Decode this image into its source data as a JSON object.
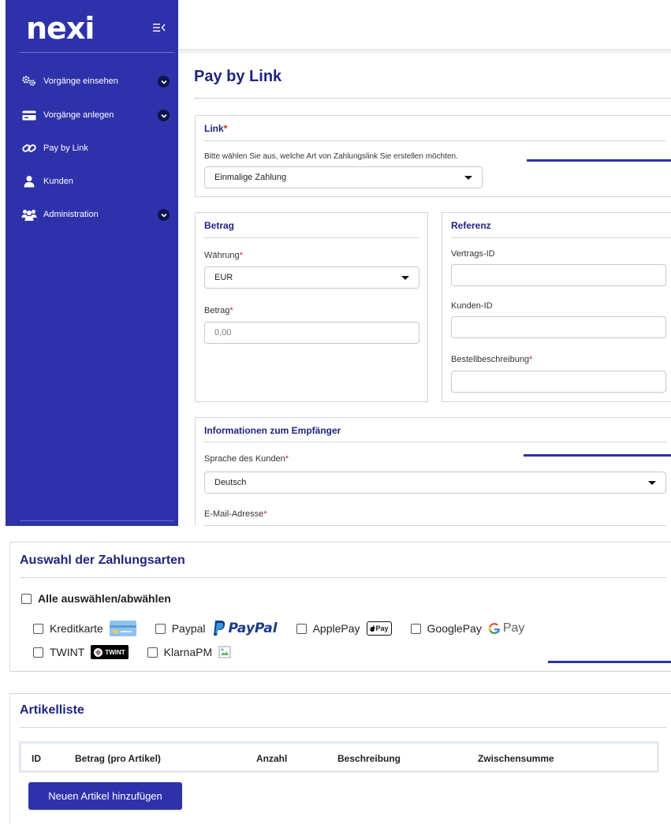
{
  "app": {
    "logo_text": "nexi"
  },
  "sidebar": {
    "items": [
      {
        "label": "Vorgänge einsehen",
        "icon": "gears-icon",
        "expandable": true
      },
      {
        "label": "Vorgänge anlegen",
        "icon": "card-icon",
        "expandable": true
      },
      {
        "label": "Pay by Link",
        "icon": "link-icon",
        "expandable": false
      },
      {
        "label": "Kunden",
        "icon": "user-icon",
        "expandable": false
      },
      {
        "label": "Administration",
        "icon": "users-icon",
        "expandable": true
      }
    ]
  },
  "page": {
    "title": "Pay by Link"
  },
  "link_panel": {
    "title": "Link",
    "required_mark": "*",
    "instruction": "Bitte wählen Sie aus, welche Art von Zahlungslink Sie erstellen möchten.",
    "type_value": "Einmalige Zahlung"
  },
  "amount_panel": {
    "title": "Betrag",
    "currency_label": "Währung",
    "currency_value": "EUR",
    "amount_label": "Betrag",
    "amount_placeholder": "0,00"
  },
  "reference_panel": {
    "title": "Referenz",
    "contract_label": "Vertrags-ID",
    "customer_label": "Kunden-ID",
    "description_label": "Bestellbeschreibung"
  },
  "recipient_panel": {
    "title": "Informationen zum Empfänger",
    "language_label": "Sprache des Kunden",
    "language_value": "Deutsch",
    "email_label": "E-Mail-Adresse"
  },
  "payment_methods": {
    "title": "Auswahl der Zahlungsarten",
    "select_all": "Alle auswählen/abwählen",
    "methods": [
      {
        "label": "Kreditkarte",
        "logo": "credit-card-logo"
      },
      {
        "label": "Paypal",
        "logo": "paypal-logo",
        "logo_text": "PayPal"
      },
      {
        "label": "ApplePay",
        "logo": "apple-pay-logo",
        "logo_text": "Pay"
      },
      {
        "label": "GooglePay",
        "logo": "google-pay-logo",
        "logo_text": "Pay"
      },
      {
        "label": "TWINT",
        "logo": "twint-logo",
        "logo_text": "TWINT"
      },
      {
        "label": "KlarnaPM",
        "logo": "broken-image-icon"
      }
    ]
  },
  "articles": {
    "title": "Artikelliste",
    "columns": [
      "ID",
      "Betrag (pro Artikel)",
      "Anzahl",
      "Beschreibung",
      "Zwischensumme"
    ],
    "add_button": "Neuen Artikel hinzufügen"
  },
  "colors": {
    "brand": "#2d32aa",
    "title": "#1f2380",
    "required": "#d21c1c"
  }
}
